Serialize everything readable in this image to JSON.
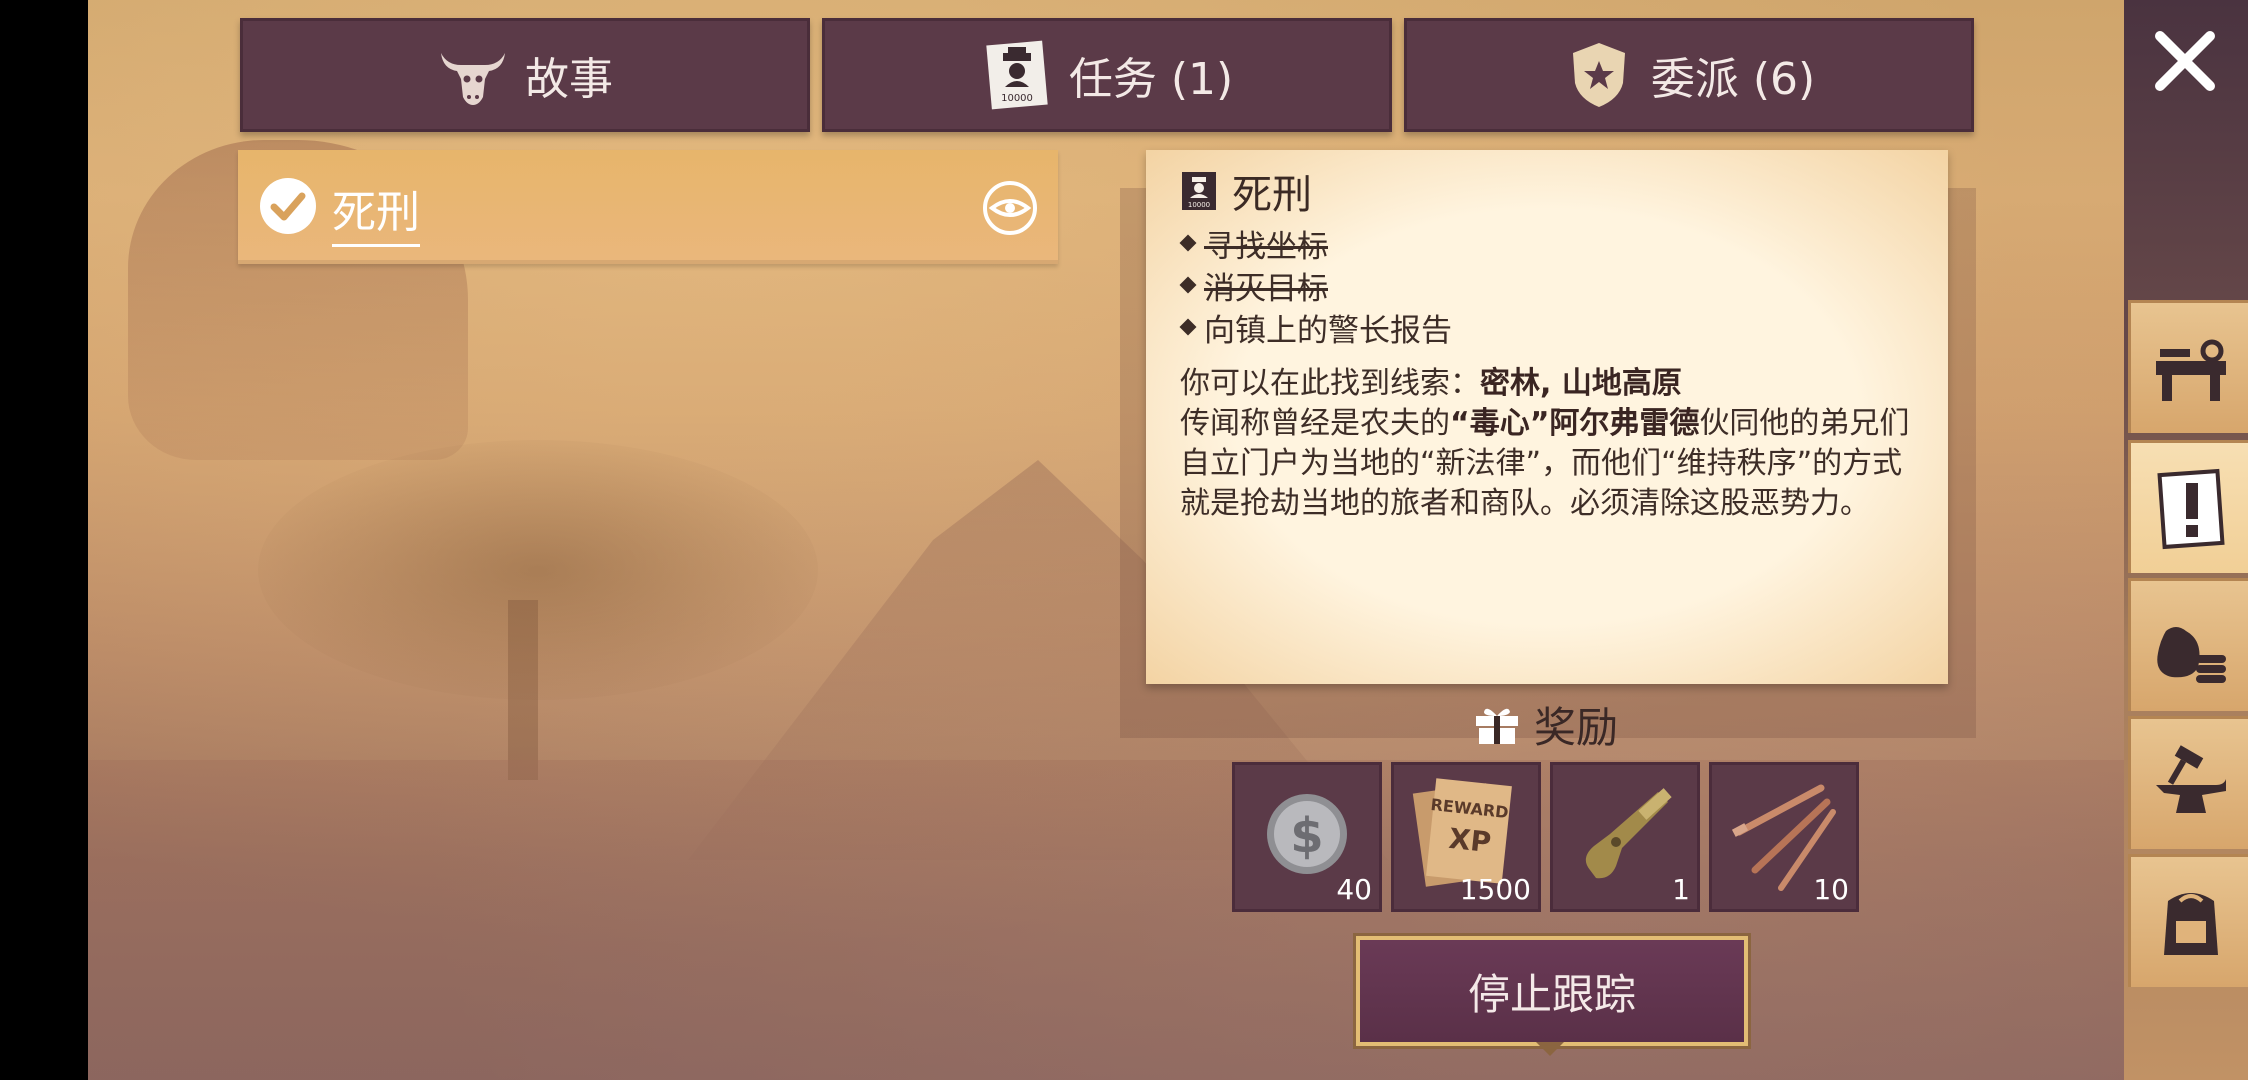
{
  "tabs": [
    {
      "label": "故事",
      "icon": "bull-skull-icon"
    },
    {
      "label": "任务 (1)",
      "icon": "wanted-poster-icon"
    },
    {
      "label": "委派 (6)",
      "icon": "sheriff-badge-icon"
    }
  ],
  "quest_list": {
    "items": [
      {
        "title": "死刑",
        "completed": true
      }
    ]
  },
  "quest_detail": {
    "title": "死刑",
    "objectives": [
      {
        "text": "寻找坐标",
        "done": true
      },
      {
        "text": "消灭目标",
        "done": true
      },
      {
        "text": "向镇上的警长报告",
        "done": false
      }
    ],
    "clue_prefix": "你可以在此找到线索：",
    "clue_locations": "密林, 山地高原",
    "story_prefix": "传闻称曾经是农夫的",
    "story_name": "“毒心”阿尔弗雷德",
    "story_rest": "伙同他的弟兄们自立门户为当地的“新法律”，而他们“维持秩序”的方式就是抢劫当地的旅者和商队。必须清除这股恶势力。"
  },
  "rewards": {
    "title": "奖励",
    "items": [
      {
        "icon": "silver-coin-icon",
        "count": "40"
      },
      {
        "icon": "reward-xp-poster-icon",
        "count": "1500"
      },
      {
        "icon": "pistol-icon",
        "count": "1"
      },
      {
        "icon": "nails-icon",
        "count": "10"
      }
    ]
  },
  "stop_tracking_label": "停止跟踪",
  "sidebar": [
    {
      "icon": "workbench-icon",
      "active": false
    },
    {
      "icon": "quest-exclamation-icon",
      "active": true
    },
    {
      "icon": "money-bags-icon",
      "active": false
    },
    {
      "icon": "anvil-icon",
      "active": false
    },
    {
      "icon": "backpack-icon",
      "active": false
    }
  ],
  "colors": {
    "tab_bg": "#5b3a48",
    "quest_item_bg": "#e7b56b",
    "panel_bg": "#fff4df",
    "button_border": "#e3bd74"
  }
}
